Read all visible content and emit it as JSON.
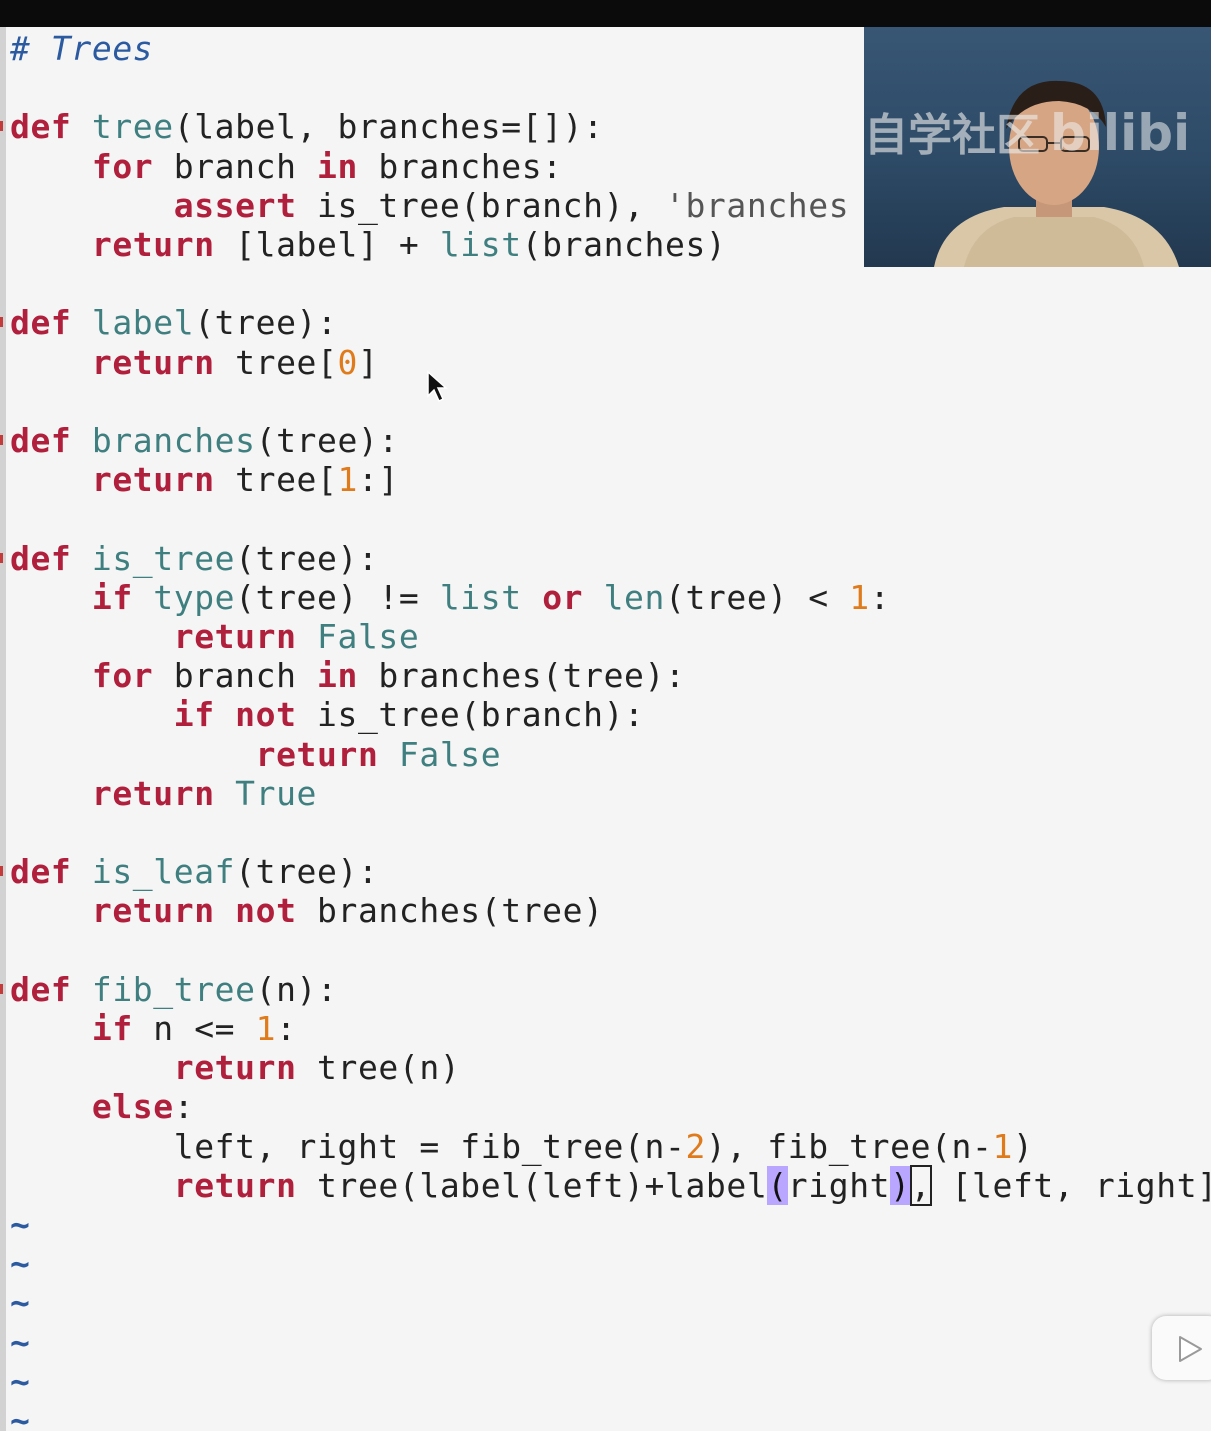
{
  "editor": {
    "lines": [
      [
        {
          "t": "# Trees",
          "c": "cm"
        }
      ],
      [],
      [
        {
          "t": "def",
          "c": "kw"
        },
        {
          "t": " "
        },
        {
          "t": "tree",
          "c": "fn"
        },
        {
          "t": "(label, branches=[]):"
        }
      ],
      [
        {
          "t": "    "
        },
        {
          "t": "for",
          "c": "kw"
        },
        {
          "t": " branch "
        },
        {
          "t": "in",
          "c": "kw"
        },
        {
          "t": " branches:"
        }
      ],
      [
        {
          "t": "        "
        },
        {
          "t": "assert",
          "c": "kw"
        },
        {
          "t": " is_tree(branch), "
        },
        {
          "t": "'branches mu",
          "c": "str"
        }
      ],
      [
        {
          "t": "    "
        },
        {
          "t": "return",
          "c": "kw"
        },
        {
          "t": " [label] + "
        },
        {
          "t": "list",
          "c": "fn"
        },
        {
          "t": "(branches)"
        }
      ],
      [],
      [
        {
          "t": "def",
          "c": "kw"
        },
        {
          "t": " "
        },
        {
          "t": "label",
          "c": "fn"
        },
        {
          "t": "(tree):"
        }
      ],
      [
        {
          "t": "    "
        },
        {
          "t": "return",
          "c": "kw"
        },
        {
          "t": " tree["
        },
        {
          "t": "0",
          "c": "num"
        },
        {
          "t": "]"
        }
      ],
      [],
      [
        {
          "t": "def",
          "c": "kw"
        },
        {
          "t": " "
        },
        {
          "t": "branches",
          "c": "fn"
        },
        {
          "t": "(tree):"
        }
      ],
      [
        {
          "t": "    "
        },
        {
          "t": "return",
          "c": "kw"
        },
        {
          "t": " tree["
        },
        {
          "t": "1",
          "c": "num"
        },
        {
          "t": ":]"
        }
      ],
      [],
      [
        {
          "t": "def",
          "c": "kw"
        },
        {
          "t": " "
        },
        {
          "t": "is_tree",
          "c": "fn"
        },
        {
          "t": "(tree):"
        }
      ],
      [
        {
          "t": "    "
        },
        {
          "t": "if",
          "c": "kw"
        },
        {
          "t": " "
        },
        {
          "t": "type",
          "c": "fn"
        },
        {
          "t": "(tree) != "
        },
        {
          "t": "list",
          "c": "fn"
        },
        {
          "t": " "
        },
        {
          "t": "or",
          "c": "kw"
        },
        {
          "t": " "
        },
        {
          "t": "len",
          "c": "fn"
        },
        {
          "t": "(tree) < "
        },
        {
          "t": "1",
          "c": "num"
        },
        {
          "t": ":"
        }
      ],
      [
        {
          "t": "        "
        },
        {
          "t": "return",
          "c": "kw"
        },
        {
          "t": " "
        },
        {
          "t": "False",
          "c": "bool"
        }
      ],
      [
        {
          "t": "    "
        },
        {
          "t": "for",
          "c": "kw"
        },
        {
          "t": " branch "
        },
        {
          "t": "in",
          "c": "kw"
        },
        {
          "t": " branches(tree):"
        }
      ],
      [
        {
          "t": "        "
        },
        {
          "t": "if",
          "c": "kw"
        },
        {
          "t": " "
        },
        {
          "t": "not",
          "c": "kw"
        },
        {
          "t": " is_tree(branch):"
        }
      ],
      [
        {
          "t": "            "
        },
        {
          "t": "return",
          "c": "kw"
        },
        {
          "t": " "
        },
        {
          "t": "False",
          "c": "bool"
        }
      ],
      [
        {
          "t": "    "
        },
        {
          "t": "return",
          "c": "kw"
        },
        {
          "t": " "
        },
        {
          "t": "True",
          "c": "bool"
        }
      ],
      [],
      [
        {
          "t": "def",
          "c": "kw"
        },
        {
          "t": " "
        },
        {
          "t": "is_leaf",
          "c": "fn"
        },
        {
          "t": "(tree):"
        }
      ],
      [
        {
          "t": "    "
        },
        {
          "t": "return",
          "c": "kw"
        },
        {
          "t": " "
        },
        {
          "t": "not",
          "c": "kw"
        },
        {
          "t": " branches(tree)"
        }
      ],
      [],
      [
        {
          "t": "def",
          "c": "kw"
        },
        {
          "t": " "
        },
        {
          "t": "fib_tree",
          "c": "fn"
        },
        {
          "t": "(n):"
        }
      ],
      [
        {
          "t": "    "
        },
        {
          "t": "if",
          "c": "kw"
        },
        {
          "t": " n <= "
        },
        {
          "t": "1",
          "c": "num"
        },
        {
          "t": ":"
        }
      ],
      [
        {
          "t": "        "
        },
        {
          "t": "return",
          "c": "kw"
        },
        {
          "t": " tree(n)"
        }
      ],
      [
        {
          "t": "    "
        },
        {
          "t": "else",
          "c": "kw"
        },
        {
          "t": ":"
        }
      ],
      [
        {
          "t": "        left, right = fib_tree(n-"
        },
        {
          "t": "2",
          "c": "num"
        },
        {
          "t": "), fib_tree(n-"
        },
        {
          "t": "1",
          "c": "num"
        },
        {
          "t": ")"
        }
      ],
      [
        {
          "t": "        "
        },
        {
          "t": "return",
          "c": "kw"
        },
        {
          "t": " tree(label(left)+label"
        },
        {
          "t": "(",
          "c": "mp"
        },
        {
          "t": "right"
        },
        {
          "t": ")",
          "c": "mp"
        },
        {
          "t": ",",
          "c": "cur"
        },
        {
          "t": " [left, right])"
        }
      ],
      [
        {
          "t": "~",
          "c": "tilde"
        }
      ],
      [
        {
          "t": "~",
          "c": "tilde"
        }
      ],
      [
        {
          "t": "~",
          "c": "tilde"
        }
      ],
      [
        {
          "t": "~",
          "c": "tilde"
        }
      ],
      [
        {
          "t": "~",
          "c": "tilde"
        }
      ],
      [
        {
          "t": "~",
          "c": "tilde"
        }
      ]
    ]
  },
  "webcam": {
    "watermark": "自学社区",
    "brand": "bilibi"
  },
  "controls": {
    "play_icon": "play-icon"
  }
}
